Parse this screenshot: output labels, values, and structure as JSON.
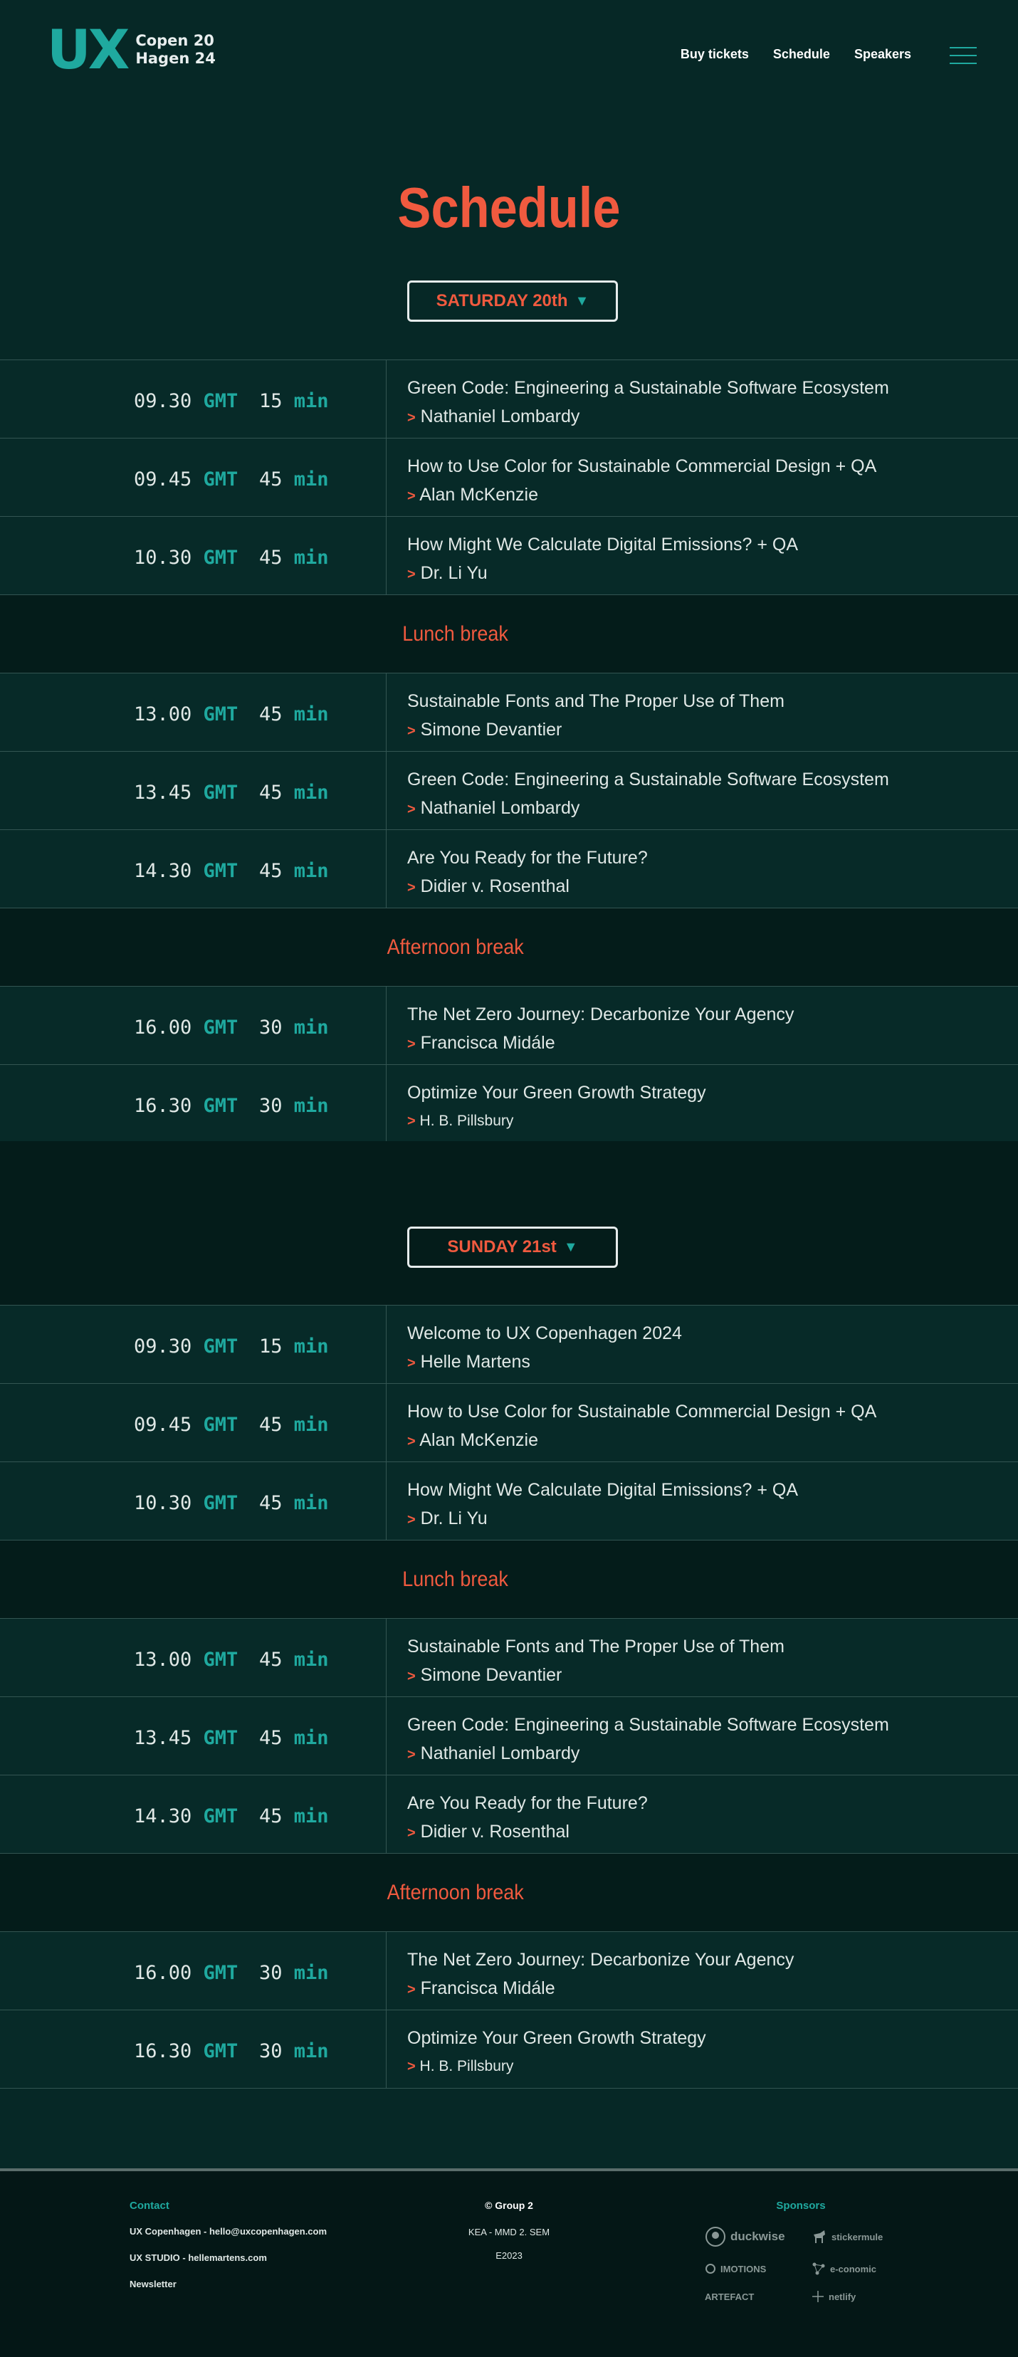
{
  "header": {
    "logo_ux": "UX",
    "logo_line1": "Copen 20",
    "logo_line2": "Hagen 24",
    "nav": [
      "Buy tickets",
      "Schedule",
      "Speakers"
    ]
  },
  "title": "Schedule",
  "days": [
    {
      "label": "SATURDAY 20th",
      "rows": [
        {
          "type": "talk",
          "time": "09.30",
          "dur": "15",
          "title": "Green Code: Engineering a Sustainable Software Ecosystem",
          "speaker": "Nathaniel Lombardy"
        },
        {
          "type": "talk",
          "time": "09.45",
          "dur": "45",
          "title": "How to Use Color for Sustainable Commercial Design + QA",
          "speaker": "Alan McKenzie"
        },
        {
          "type": "talk",
          "time": "10.30",
          "dur": "45",
          "title": "How Might We Calculate Digital Emissions? + QA",
          "speaker": "Dr. Li Yu"
        },
        {
          "type": "break",
          "label": "Lunch break"
        },
        {
          "type": "talk",
          "time": "13.00",
          "dur": "45",
          "title": "Sustainable Fonts and The Proper Use of Them",
          "speaker": "Simone Devantier"
        },
        {
          "type": "talk",
          "time": "13.45",
          "dur": "45",
          "title": "Green Code: Engineering a Sustainable Software Ecosystem",
          "speaker": "Nathaniel Lombardy"
        },
        {
          "type": "talk",
          "time": "14.30",
          "dur": "45",
          "title": "Are You Ready for the Future?",
          "speaker": "Didier v.  Rosenthal"
        },
        {
          "type": "break",
          "label": "Afternoon break"
        },
        {
          "type": "talk",
          "time": "16.00",
          "dur": "30",
          "title": "The Net Zero Journey: Decarbonize Your Agency",
          "speaker": "Francisca Midále"
        },
        {
          "type": "talk",
          "time": "16.30",
          "dur": "30",
          "title": "Optimize Your Green Growth Strategy",
          "speaker": "H. B. Pillsbury",
          "small": true
        }
      ]
    },
    {
      "label": "SUNDAY 21st",
      "rows": [
        {
          "type": "talk",
          "time": "09.30",
          "dur": "15",
          "title": "Welcome to UX Copenhagen 2024",
          "speaker": "Helle Martens"
        },
        {
          "type": "talk",
          "time": "09.45",
          "dur": "45",
          "title": "How to Use Color for Sustainable Commercial Design + QA",
          "speaker": "Alan McKenzie"
        },
        {
          "type": "talk",
          "time": "10.30",
          "dur": "45",
          "title": "How Might We Calculate Digital Emissions? + QA",
          "speaker": "Dr. Li Yu"
        },
        {
          "type": "break",
          "label": "Lunch break"
        },
        {
          "type": "talk",
          "time": "13.00",
          "dur": "45",
          "title": "Sustainable Fonts and The Proper Use of Them",
          "speaker": "Simone Devantier"
        },
        {
          "type": "talk",
          "time": "13.45",
          "dur": "45",
          "title": "Green Code: Engineering a Sustainable Software Ecosystem",
          "speaker": "Nathaniel Lombardy"
        },
        {
          "type": "talk",
          "time": "14.30",
          "dur": "45",
          "title": "Are You Ready for the Future?",
          "speaker": "Didier v.  Rosenthal"
        },
        {
          "type": "break",
          "label": "Afternoon break"
        },
        {
          "type": "talk",
          "time": "16.00",
          "dur": "30",
          "title": "The Net Zero Journey: Decarbonize Your Agency",
          "speaker": "Francisca Midále"
        },
        {
          "type": "talk",
          "time": "16.30",
          "dur": "30",
          "title": "Optimize Your Green Growth Strategy",
          "speaker": "H. B. Pillsbury",
          "small": true
        }
      ]
    }
  ],
  "labels": {
    "gmt": "GMT",
    "min": "min",
    "arrow": ">",
    "caret": "▼"
  },
  "footer": {
    "contact_head": "Contact",
    "contact_lines": [
      "UX Copenhagen - hello@uxcopenhagen.com",
      "UX STUDIO - hellemartens.com",
      "Newsletter"
    ],
    "center_lines": [
      "© Group 2",
      "KEA - MMD 2. SEM",
      "E2023"
    ],
    "sponsors_head": "Sponsors",
    "sponsors": [
      "duckwise",
      "stickermule",
      "IMOTIONS",
      "e-conomic",
      "ARTEFACT",
      "netlify"
    ]
  },
  "colors": {
    "background": "#062826",
    "accent": "#1fa99f",
    "highlight": "#f05a3f"
  }
}
